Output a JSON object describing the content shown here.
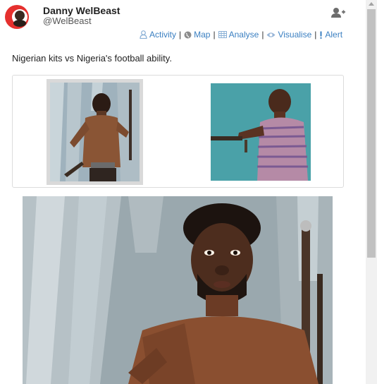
{
  "user": {
    "name": "Danny WelBeast",
    "handle": "@WelBeast",
    "avatar_icon": "avatar-logo-icon",
    "follow_icon": "add-user-icon"
  },
  "actions": [
    {
      "label": "Activity",
      "icon": "person-icon"
    },
    {
      "label": "Map",
      "icon": "globe-icon"
    },
    {
      "label": "Analyse",
      "icon": "grid-icon"
    },
    {
      "label": "Visualise",
      "icon": "eye-icon"
    },
    {
      "label": "Alert",
      "icon": "exclamation-icon"
    }
  ],
  "tweet": {
    "text": "Nigerian kits vs Nigeria's football ability."
  },
  "colors": {
    "link": "#3a7fc1",
    "avatar_red": "#e5302e"
  }
}
